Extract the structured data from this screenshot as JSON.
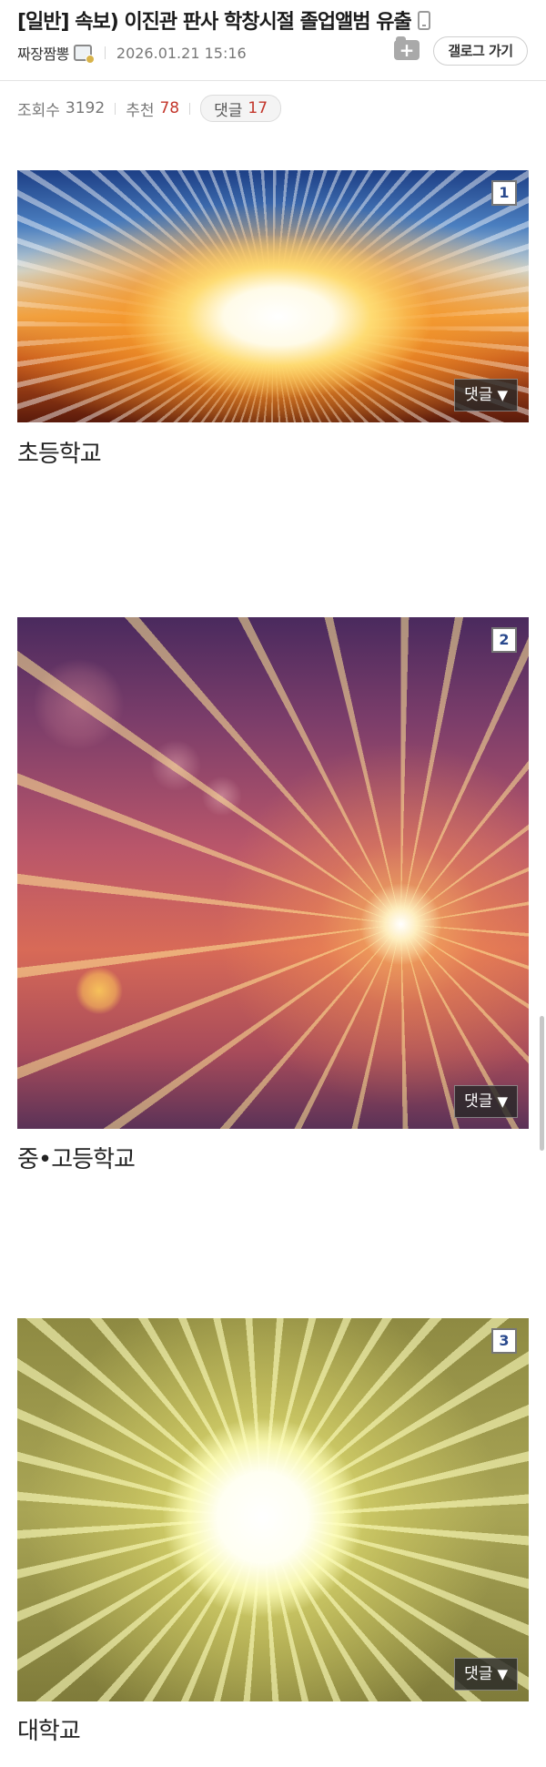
{
  "post": {
    "title": "[일반] 속보) 이진관 판사 학창시절 졸업앨범 유출",
    "author": "짜장짬뽕",
    "date": "2026.01.21 15:16",
    "gallery_button": "갤로그 가기"
  },
  "stats": {
    "views_label": "조회수",
    "views": "3192",
    "recommend_label": "추천",
    "recommend": "78",
    "comments_label": "댓글",
    "comments": "17"
  },
  "images": [
    {
      "number": "1",
      "comment_label": "댓글",
      "arrow": "▼",
      "caption": "초등학교"
    },
    {
      "number": "2",
      "comment_label": "댓글",
      "arrow": "▼",
      "caption": "중•고등학교"
    },
    {
      "number": "3",
      "comment_label": "댓글",
      "arrow": "▼",
      "caption": "대학교"
    }
  ],
  "icons": {
    "mobile": "mobile-icon",
    "author_badge": "fixed-nick-icon",
    "scrap": "scrap-folder-plus-icon"
  },
  "colors": {
    "recommend_count": "#c3362b",
    "comment_count": "#c3362b",
    "number_badge_text": "#2a4a8e"
  }
}
